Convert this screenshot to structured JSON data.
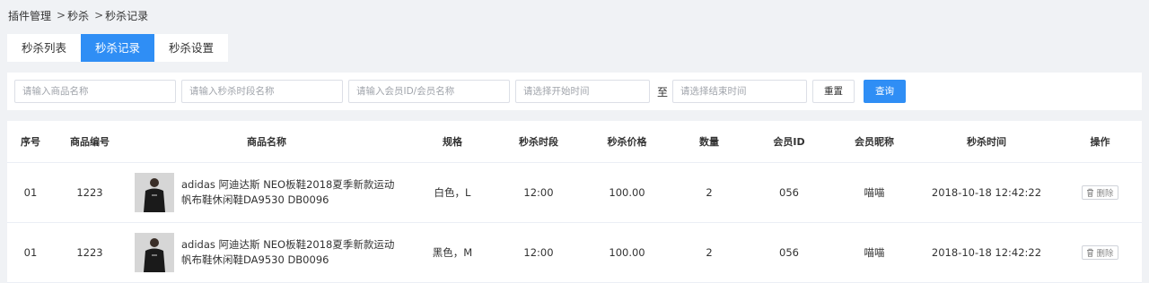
{
  "breadcrumb": {
    "root": "插件管理",
    "level1": "秒杀",
    "level2": "秒杀记录"
  },
  "tabs": [
    {
      "label": "秒杀列表",
      "active": false
    },
    {
      "label": "秒杀记录",
      "active": true
    },
    {
      "label": "秒杀设置",
      "active": false
    }
  ],
  "filters": {
    "product_name_placeholder": "请输入商品名称",
    "time_slot_placeholder": "请输入秒杀时段名称",
    "member_placeholder": "请输入会员ID/会员名称",
    "start_time_placeholder": "请选择开始时间",
    "range_to": "至",
    "end_time_placeholder": "请选择结束时间",
    "reset_label": "重置",
    "query_label": "查询"
  },
  "table": {
    "headers": {
      "index": "序号",
      "product_code": "商品编号",
      "product_name": "商品名称",
      "spec": "规格",
      "time_slot": "秒杀时段",
      "price": "秒杀价格",
      "quantity": "数量",
      "member_id": "会员ID",
      "nickname": "会员昵称",
      "seckill_time": "秒杀时间",
      "action": "操作"
    },
    "rows": [
      {
        "index": "01",
        "product_code": "1223",
        "product_name_line1": "adidas 阿迪达斯 NEO板鞋2018夏季新款运动",
        "product_name_line2": "帆布鞋休闲鞋DA9530 DB0096",
        "spec": "白色，L",
        "time_slot": "12:00",
        "price": "100.00",
        "quantity": "2",
        "member_id": "056",
        "nickname": "喵喵",
        "seckill_time": "2018-10-18 12:42:22",
        "delete_label": "删除"
      },
      {
        "index": "01",
        "product_code": "1223",
        "product_name_line1": "adidas 阿迪达斯 NEO板鞋2018夏季新款运动",
        "product_name_line2": "帆布鞋休闲鞋DA9530 DB0096",
        "spec": "黑色，M",
        "time_slot": "12:00",
        "price": "100.00",
        "quantity": "2",
        "member_id": "056",
        "nickname": "喵喵",
        "seckill_time": "2018-10-18 12:42:22",
        "delete_label": "删除"
      }
    ]
  },
  "colors": {
    "accent": "#2f8ef5",
    "page_bg": "#f0f2f5"
  }
}
